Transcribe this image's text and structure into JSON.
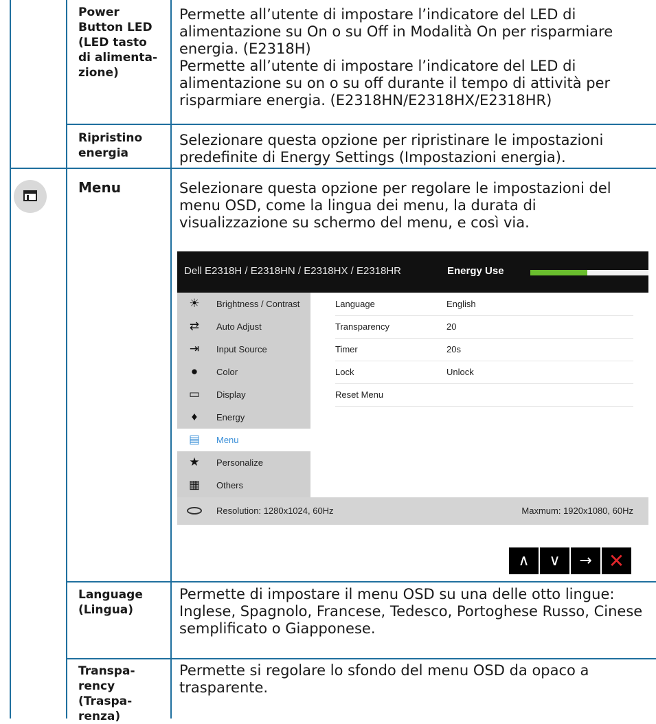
{
  "rows": [
    {
      "name_lines": [
        "Power",
        "Button LED",
        "(LED tasto",
        "di alimenta-",
        "zione)"
      ],
      "desc": [
        "Permette all’utente di impostare l’indicatore del LED di alimentazione su On o su Off in Modalità On per risparmiare energia. (E2318H)",
        "Permette all’utente di impostare l’indicatore del LED di alimentazione su on o su off durante il tempo di attività per risparmiare energia. (E2318HN/E2318HX/E2318HR)"
      ]
    },
    {
      "name_lines": [
        "Ripristino",
        "energia"
      ],
      "desc": [
        "Selezionare questa opzione per ripristinare le impostazioni predefinite di Energy Settings (Impostazioni energia)."
      ]
    },
    {
      "name_lines": [
        "Menu"
      ],
      "icon": "menu-window-icon",
      "desc": [
        "Selezionare questa opzione per regolare le impostazioni del menu OSD, come la lingua dei menu, la durata di visualizzazione su schermo del menu, e così via."
      ]
    },
    {
      "name_lines": [
        "Language",
        "(Lingua)"
      ],
      "desc": [
        "Permette di impostare il menu OSD su una delle otto lingue: Inglese, Spagnolo, Francese, Tedesco, Portoghese Russo, Cinese semplificato o Giapponese."
      ]
    },
    {
      "name_lines": [
        "Transpa-",
        "rency",
        "(Traspa-",
        "renza)"
      ],
      "desc": [
        "Permette si regolare lo sfondo del menu OSD da opaco a trasparente."
      ]
    }
  ],
  "osd": {
    "title": "Dell E2318H / E2318HN / E2318HX / E2318HR",
    "energy_label": "Energy Use",
    "energy_level": 0.48,
    "menu_items": [
      {
        "label": "Brightness / Contrast",
        "icon": "sun-icon",
        "glyph": "☀"
      },
      {
        "label": "Auto Adjust",
        "icon": "auto-adjust-icon",
        "glyph": "⇄"
      },
      {
        "label": "Input Source",
        "icon": "input-source-icon",
        "glyph": "⇥"
      },
      {
        "label": "Color",
        "icon": "color-icon",
        "glyph": "●"
      },
      {
        "label": "Display",
        "icon": "display-icon",
        "glyph": "▭"
      },
      {
        "label": "Energy",
        "icon": "energy-icon",
        "glyph": "♦"
      },
      {
        "label": "Menu",
        "icon": "menu-icon",
        "glyph": "▤",
        "active": true
      },
      {
        "label": "Personalize",
        "icon": "star-icon",
        "glyph": "★"
      },
      {
        "label": "Others",
        "icon": "others-icon",
        "glyph": "▦"
      }
    ],
    "settings": [
      {
        "key": "Language",
        "value": "English"
      },
      {
        "key": "Transparency",
        "value": "20"
      },
      {
        "key": "Timer",
        "value": "20s"
      },
      {
        "key": "Lock",
        "value": "Unlock"
      },
      {
        "key": "Reset Menu",
        "value": ""
      }
    ],
    "resolution": "Resolution: 1280x1024, 60Hz",
    "maximum": "Maxmum: 1920x1080, 60Hz",
    "nav_buttons": [
      {
        "glyph": "∧",
        "icon": "up-arrow-icon"
      },
      {
        "glyph": "∨",
        "icon": "down-arrow-icon"
      },
      {
        "glyph": "→",
        "icon": "right-arrow-icon"
      },
      {
        "glyph": "✕",
        "icon": "close-icon"
      }
    ]
  }
}
